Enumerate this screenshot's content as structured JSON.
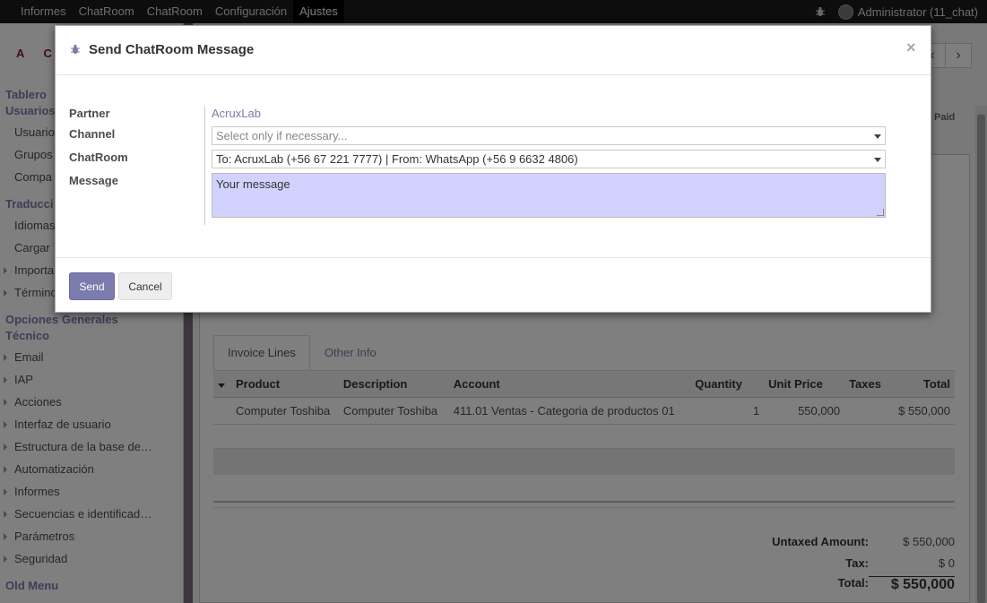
{
  "topbar": {
    "menu": [
      "Informes",
      "ChatRoom",
      "ChatRoom",
      "Configuración",
      "Ajustes"
    ],
    "active_index": 4,
    "user_label": "Administrator (11_chat)"
  },
  "sidebar": {
    "logo": "A C",
    "sections": {
      "tablero": "Tablero",
      "usuarios": "Usuarios",
      "traducciones": "Traducci",
      "opciones": "Opciones Generales",
      "tecnico": "Técnico",
      "old_menu": "Old Menu"
    },
    "users_items": [
      "Usuario",
      "Grupos",
      "Compa"
    ],
    "translation_items": [
      "Idiomas",
      "Cargar",
      "Importa",
      "Término"
    ],
    "technical_items": [
      "Email",
      "IAP",
      "Acciones",
      "Interfaz de usuario",
      "Estructura de la base de…",
      "Automatización",
      "Informes",
      "Secuencias e identificad…",
      "Parámetros",
      "Seguridad"
    ]
  },
  "invoice": {
    "status": "Paid",
    "tabs": [
      "Invoice Lines",
      "Other Info"
    ],
    "columns": [
      "Product",
      "Description",
      "Account",
      "Quantity",
      "Unit Price",
      "Taxes",
      "Total"
    ],
    "rows": [
      {
        "product": "Computer Toshiba",
        "description": "Computer Toshiba",
        "account": "411.01 Ventas - Categoria de productos 01",
        "quantity": "1",
        "unit_price": "550,000",
        "taxes": "",
        "total": "$ 550,000"
      }
    ],
    "totals": {
      "untaxed_label": "Untaxed Amount:",
      "untaxed_value": "$ 550,000",
      "tax_label": "Tax:",
      "tax_value": "$ 0",
      "total_label": "Total:",
      "total_value": "$ 550,000"
    }
  },
  "modal": {
    "title": "Send ChatRoom Message",
    "close": "×",
    "labels": {
      "partner": "Partner",
      "channel": "Channel",
      "chatroom": "ChatRoom",
      "message": "Message"
    },
    "partner_value": "AcruxLab",
    "channel_placeholder": "Select only if necessary...",
    "chatroom_value": "To: AcruxLab (+56 67 221 7777) | From: WhatsApp (+56 9 6632 4806)",
    "message_value": "Your message",
    "send_label": "Send",
    "cancel_label": "Cancel"
  },
  "colors": {
    "accent": "#7c7bad",
    "message_bg": "#d2d2ff",
    "topbar": "#1a1a1a"
  }
}
